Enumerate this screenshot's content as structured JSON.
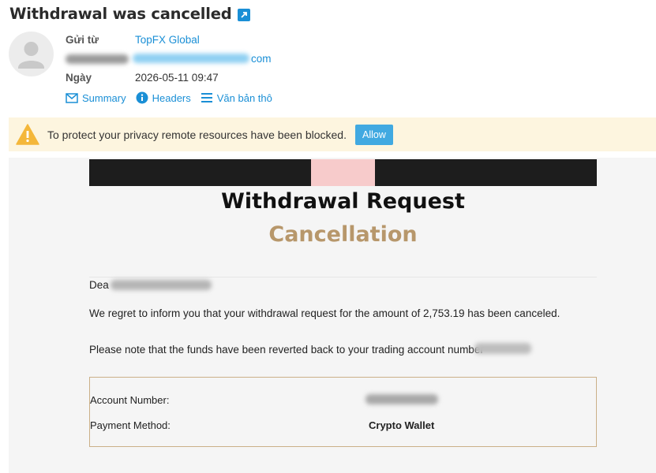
{
  "message": {
    "subject": "Withdrawal was cancelled",
    "from_label": "Gửi từ",
    "from_name": "TopFX Global",
    "from_email_suffix": "com",
    "date_label": "Ngày",
    "date_value": "2026-05-11 09:47"
  },
  "header_links": [
    {
      "label": "Summary",
      "icon": "envelope-icon"
    },
    {
      "label": "Headers",
      "icon": "info-icon"
    },
    {
      "label": "Văn bản thô",
      "icon": "lines-icon"
    }
  ],
  "privacy_banner": {
    "text": "To protect your privacy remote resources have been blocked.",
    "button_label": "Allow",
    "icon": "warning-icon"
  },
  "email_body": {
    "title_line1": "Withdrawal Request",
    "title_line2": "Cancellation",
    "greeting": "Dea",
    "paragraph1": "We regret to inform you that your withdrawal request for the amount of 2,753.19 has been canceled.",
    "paragraph2": "Please note that the funds have been reverted back to your trading account number",
    "details": {
      "account_number_label": "Account Number:",
      "payment_method_label": "Payment Method:",
      "payment_method_value": "Crypto Wallet"
    }
  },
  "colors": {
    "link": "#1a8fd6",
    "privacy_bg": "#fdf5df",
    "allow_button": "#41a9e1",
    "title_accent": "#b7976b",
    "banner_dark": "#1d1d1d",
    "banner_pink": "#f7cbcb",
    "box_border": "#cbb088"
  }
}
